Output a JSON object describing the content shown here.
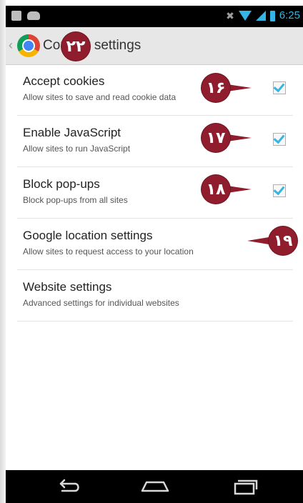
{
  "status_bar": {
    "time": "6:25",
    "icons": [
      "notification-square-icon",
      "notification-android-icon",
      "mute-icon",
      "wifi-icon",
      "signal-icon",
      "battery-icon"
    ],
    "accent_color": "#33b5e5"
  },
  "action_bar": {
    "up_glyph": "‹",
    "title": "Content settings",
    "app_icon": "chrome-icon"
  },
  "settings": [
    {
      "title": "Accept cookies",
      "summary": "Allow sites to save and read cookie data",
      "checked": true
    },
    {
      "title": "Enable JavaScript",
      "summary": "Allow sites to run JavaScript",
      "checked": true
    },
    {
      "title": "Block pop-ups",
      "summary": "Block pop-ups from all sites",
      "checked": true
    },
    {
      "title": "Google location settings",
      "summary": "Allow sites to request access to your location"
    },
    {
      "title": "Website settings",
      "summary": "Advanced settings for individual websites"
    }
  ],
  "markers": {
    "title": "۲۲",
    "cookies": "۱۶",
    "javascript": "۱۷",
    "popups": "۱۸",
    "location": "۱۹",
    "color": "#8f1d2d"
  },
  "nav_bar": {
    "buttons": [
      "back-icon",
      "home-icon",
      "recent-apps-icon"
    ]
  }
}
